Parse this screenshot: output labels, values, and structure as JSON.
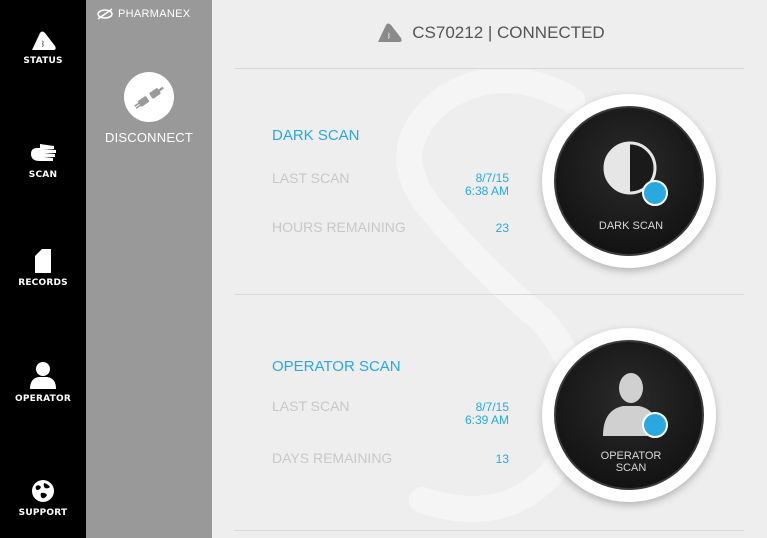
{
  "nav": {
    "items": [
      {
        "label": "STATUS",
        "icon": "device-icon"
      },
      {
        "label": "SCAN",
        "icon": "hand-icon"
      },
      {
        "label": "RECORDS",
        "icon": "document-icon"
      },
      {
        "label": "OPERATOR",
        "icon": "person-icon"
      },
      {
        "label": "SUPPORT",
        "icon": "globe-icon"
      }
    ]
  },
  "panel": {
    "brand": "PHARMANEX",
    "disconnect_label": "DISCONNECT"
  },
  "header": {
    "device_status": "CS70212 | CONNECTED"
  },
  "dark_scan": {
    "title": "DARK SCAN",
    "last_scan_label": "LAST SCAN",
    "last_scan_date": "8/7/15",
    "last_scan_time": "6:38 AM",
    "remaining_label": "HOURS REMAINING",
    "remaining_value": "23",
    "button_label": "DARK SCAN"
  },
  "operator_scan": {
    "title": "OPERATOR SCAN",
    "last_scan_label": "LAST SCAN",
    "last_scan_date": "8/7/15",
    "last_scan_time": "6:39 AM",
    "remaining_label": "DAYS REMAINING",
    "remaining_value": "13",
    "button_label_line1": "OPERATOR",
    "button_label_line2": "SCAN"
  },
  "colors": {
    "accent": "#29a9df",
    "nav_bg": "#000000",
    "panel_bg": "#999999",
    "main_bg": "#eeeeee"
  }
}
